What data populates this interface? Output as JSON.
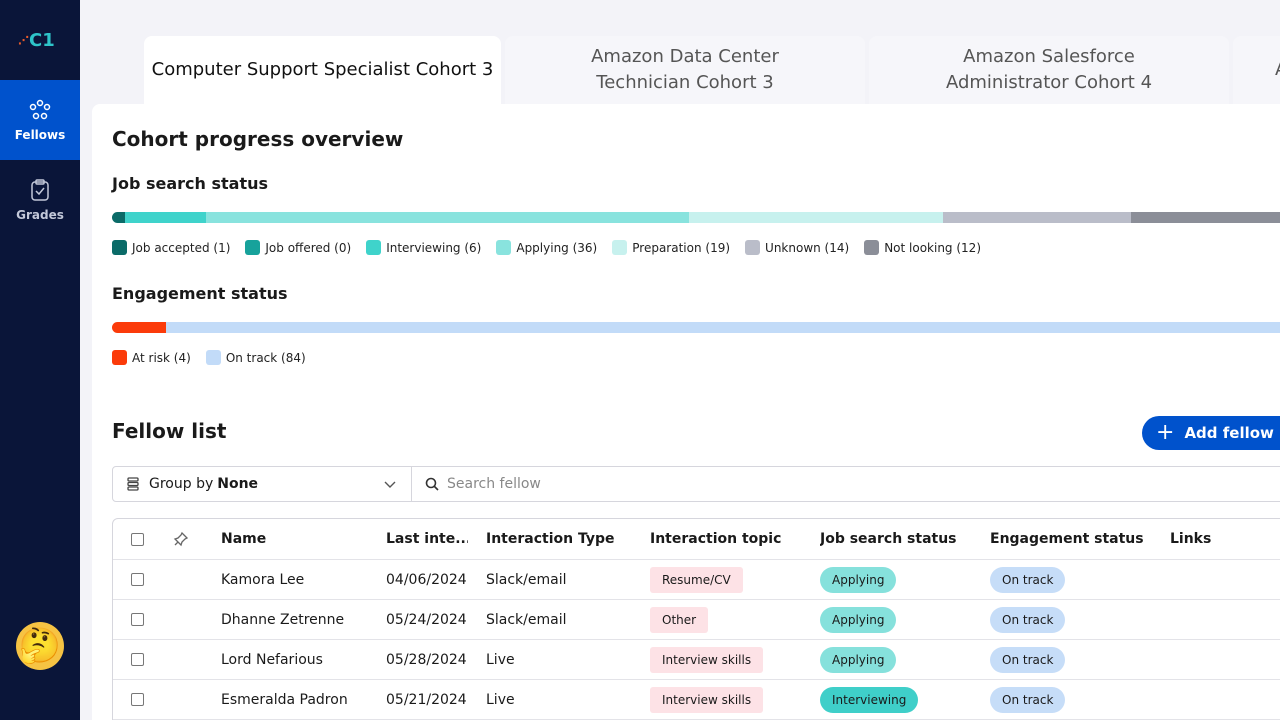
{
  "logo": {
    "text": "C1"
  },
  "nav": {
    "fellows": "Fellows",
    "grades": "Grades"
  },
  "tabs": [
    {
      "label": "Computer Support Specialist Cohort 3"
    },
    {
      "label": "Amazon Data Center Technician Cohort 3"
    },
    {
      "label": "Amazon Salesforce Administrator Cohort 4"
    },
    {
      "label": "A"
    }
  ],
  "overview": {
    "title": "Cohort progress overview",
    "job_title": "Job search status",
    "engagement_title": "Engagement status"
  },
  "job_status": [
    {
      "label": "Job accepted (1)",
      "count": 1,
      "color": "#0b6b68"
    },
    {
      "label": "Job offered (0)",
      "count": 0,
      "color": "#17a29b"
    },
    {
      "label": "Interviewing (6)",
      "count": 6,
      "color": "#3fd3cb"
    },
    {
      "label": "Applying (36)",
      "count": 36,
      "color": "#89e3de"
    },
    {
      "label": "Preparation (19)",
      "count": 19,
      "color": "#c7f1ee"
    },
    {
      "label": "Unknown (14)",
      "count": 14,
      "color": "#babdc9"
    },
    {
      "label": "Not looking (12)",
      "count": 12,
      "color": "#8b8e98"
    }
  ],
  "engagement_status": [
    {
      "label": "At risk (4)",
      "count": 4,
      "color": "#fb3b0a"
    },
    {
      "label": "On track (84)",
      "count": 84,
      "color": "#c2dbf8"
    }
  ],
  "fellow_list": {
    "title": "Fellow list",
    "add_button": "Add fellow up",
    "group_by_label": "Group by",
    "group_by_value": "None",
    "search_placeholder": "Search fellow"
  },
  "table": {
    "headers": {
      "name": "Name",
      "last_interaction": "Last inte...",
      "interaction_type": "Interaction Type",
      "interaction_topic": "Interaction topic",
      "job_search_status": "Job search status",
      "engagement_status": "Engagement status",
      "links": "Links"
    },
    "rows": [
      {
        "name": "Kamora Lee",
        "date": "04/06/2024",
        "type": "Slack/email",
        "topic": "Resume/CV",
        "job": "Applying",
        "engagement": "On track"
      },
      {
        "name": "Dhanne Zetrenne",
        "date": "05/24/2024",
        "type": "Slack/email",
        "topic": "Other",
        "job": "Applying",
        "engagement": "On track"
      },
      {
        "name": "Lord Nefarious",
        "date": "05/28/2024",
        "type": "Live",
        "topic": "Interview skills",
        "job": "Applying",
        "engagement": "On track"
      },
      {
        "name": "Esmeralda Padron",
        "date": "05/21/2024",
        "type": "Live",
        "topic": "Interview skills",
        "job": "Interviewing",
        "engagement": "On track"
      }
    ]
  }
}
